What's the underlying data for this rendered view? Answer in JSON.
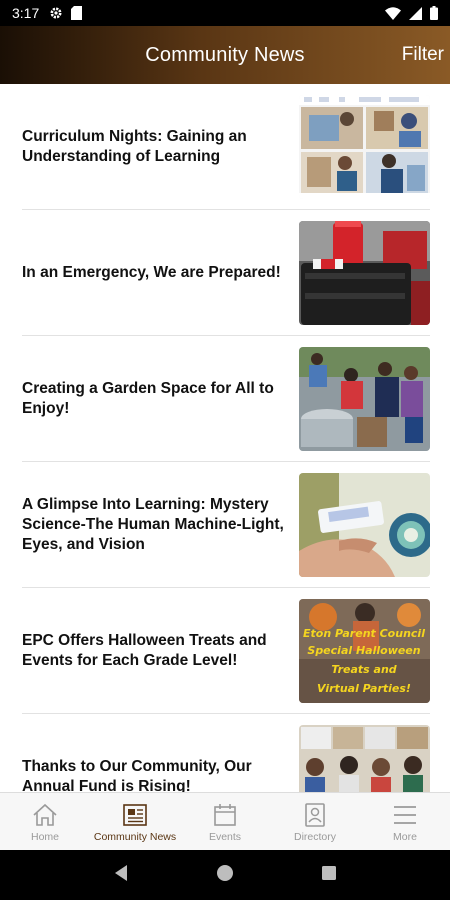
{
  "status_bar": {
    "time": "3:17",
    "left_icons": [
      "gear-icon",
      "sd-card-icon"
    ],
    "right_icons": [
      "wifi-icon",
      "signal-icon",
      "battery-icon"
    ]
  },
  "app_bar": {
    "title": "Community News",
    "filter_label": "Filter",
    "gradient_colors": [
      "#1a0f05",
      "#5a3614",
      "#8a5a26"
    ]
  },
  "news_items": [
    {
      "title": "Curriculum Nights: Gaining an Understanding of Learning",
      "thumbnail": "classroom-collage-photo"
    },
    {
      "title": "In an Emergency, We are Prepared!",
      "thumbnail": "emergency-kit-photo"
    },
    {
      "title": "Creating a Garden Space for All to Enjoy!",
      "thumbnail": "garden-volunteers-photo"
    },
    {
      "title": "A Glimpse Into Learning: Mystery Science-The Human Machine-Light, Eyes, and Vision",
      "thumbnail": "science-lens-photo"
    },
    {
      "title": "EPC Offers Halloween Treats and Events for Each Grade Level!",
      "thumbnail": "halloween-flyer",
      "thumbnail_text": "Eton Parent Council Special Halloween Treats and Virtual Parties!"
    },
    {
      "title": "Thanks to Our Community, Our Annual Fund is Rising!",
      "thumbnail": "community-collage-photo"
    }
  ],
  "bottom_nav": [
    {
      "label": "Home",
      "icon": "home-icon",
      "active": false
    },
    {
      "label": "Community News",
      "icon": "newspaper-icon",
      "active": true
    },
    {
      "label": "Events",
      "icon": "calendar-icon",
      "active": false
    },
    {
      "label": "Directory",
      "icon": "contact-card-icon",
      "active": false
    },
    {
      "label": "More",
      "icon": "menu-icon",
      "active": false
    }
  ],
  "system_nav": [
    "back-icon",
    "home-circle-icon",
    "recents-icon"
  ],
  "colors": {
    "active_nav": "#5a3614",
    "inactive_nav": "#9a9a9a",
    "headline": "#111111"
  }
}
